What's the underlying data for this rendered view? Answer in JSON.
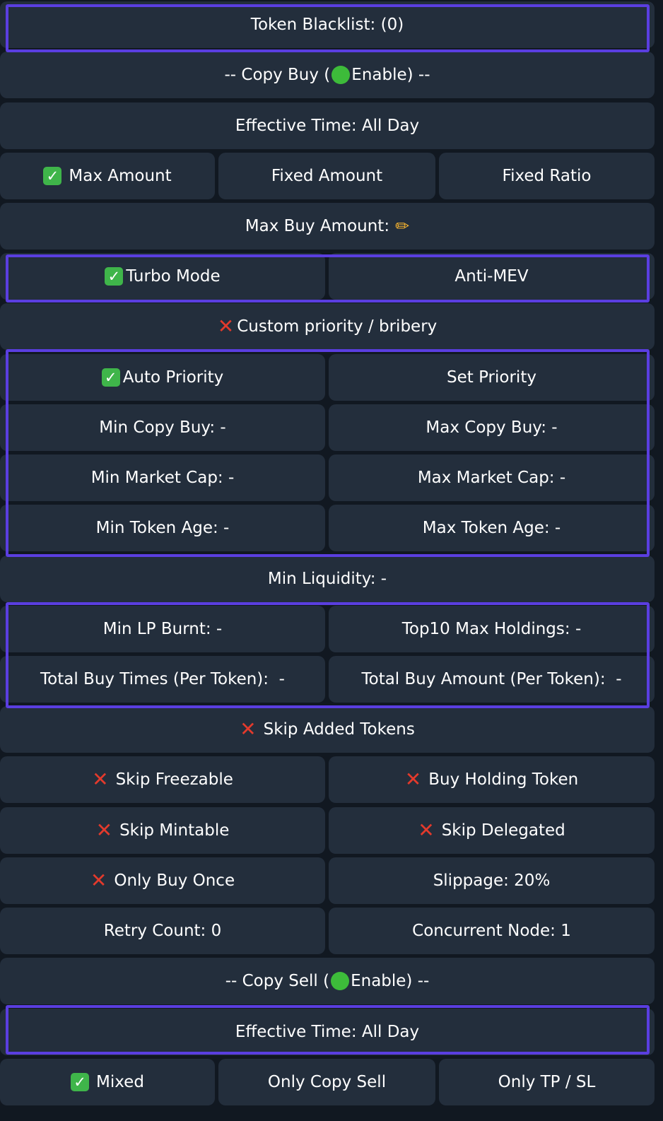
{
  "colors": {
    "background": "#111821",
    "button": "#232e3c",
    "highlight": "#5a3ee0",
    "check": "#3fb54a",
    "cross": "#e33a2c",
    "enable_dot": "#3dbb3a"
  },
  "token_blacklist": "Token Blacklist: (0)",
  "copy_buy": {
    "prefix": "-- Copy Buy (",
    "status": "Enable",
    "suffix": ") --",
    "status_icon": "green-circle"
  },
  "buy_effective_time": "Effective Time: All Day",
  "amount_modes": [
    {
      "label": "Max Amount",
      "selected": true
    },
    {
      "label": "Fixed Amount",
      "selected": false
    },
    {
      "label": "Fixed Ratio",
      "selected": false
    }
  ],
  "max_buy_amount": {
    "label": "Max Buy Amount:",
    "icon": "pencil-icon"
  },
  "turbo_mode": {
    "label": "Turbo Mode",
    "enabled": true
  },
  "anti_mev": {
    "label": "Anti-MEV"
  },
  "custom_priority": {
    "label": "Custom priority / bribery",
    "enabled": false
  },
  "auto_priority": {
    "label": "Auto Priority",
    "enabled": true
  },
  "set_priority": {
    "label": "Set Priority"
  },
  "min_copy_buy": "Min Copy Buy: -",
  "max_copy_buy": "Max Copy Buy: -",
  "min_market_cap": "Min Market Cap: -",
  "max_market_cap": "Max Market Cap: -",
  "min_token_age": "Min Token Age: -",
  "max_token_age": "Max Token Age: -",
  "min_liquidity": "Min Liquidity: -",
  "min_lp_burnt": "Min LP Burnt: -",
  "top10_max_holdings": "Top10 Max Holdings: -",
  "total_buy_times": "Total Buy Times (Per Token):  -",
  "total_buy_amount": "Total Buy Amount (Per Token):  -",
  "skip_added_tokens": {
    "label": "Skip Added Tokens",
    "enabled": false
  },
  "skip_freezable": {
    "label": "Skip Freezable",
    "enabled": false
  },
  "buy_holding_token": {
    "label": "Buy Holding Token",
    "enabled": false
  },
  "skip_mintable": {
    "label": "Skip Mintable",
    "enabled": false
  },
  "skip_delegated": {
    "label": "Skip Delegated",
    "enabled": false
  },
  "only_buy_once": {
    "label": "Only Buy Once",
    "enabled": false
  },
  "slippage": "Slippage: 20%",
  "retry_count": "Retry Count: 0",
  "concurrent_node": "Concurrent Node: 1",
  "copy_sell": {
    "prefix": "-- Copy Sell (",
    "status": "Enable",
    "suffix": ") --",
    "status_icon": "green-circle"
  },
  "sell_effective_time": "Effective Time: All Day",
  "sell_modes": [
    {
      "label": "Mixed",
      "selected": true
    },
    {
      "label": "Only Copy Sell",
      "selected": false
    },
    {
      "label": "Only TP / SL",
      "selected": false
    }
  ],
  "icons": {
    "check": "✓",
    "cross": "✕",
    "pencil": "✏"
  }
}
